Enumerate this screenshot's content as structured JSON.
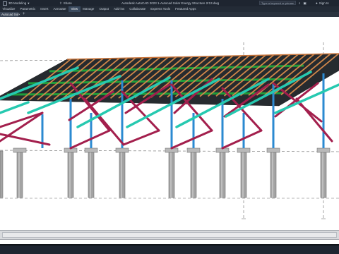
{
  "titlebar": {
    "workspace": "3D Modeling",
    "share": "Share",
    "title": "Autodesk AutoCAD 2023   1-Autocad Solar Energy Structure 2r13.dwg",
    "search_placeholder": "Type a keyword or phrase",
    "sign_in": "Sign In"
  },
  "ribbon": {
    "tabs": [
      "Visualize",
      "Parametric",
      "Insert",
      "Annotate",
      "View",
      "Manage",
      "Output",
      "Add-ins",
      "Collaborate",
      "Express Tools",
      "Featured Apps"
    ],
    "active_tab": "View"
  },
  "document_tab": {
    "label": "Autocad Solar Energy Structure 2r13*",
    "close": "×",
    "add": "+"
  },
  "colors": {
    "panel": "#262b2f",
    "panel_stripe": "#1f9e3a",
    "rafter": "#d1874a",
    "beam": "#26c9b0",
    "brace": "#a31f4d",
    "column": "#2b8ad1",
    "pile": "#9c9c9c",
    "chrome": "#1e2530"
  },
  "icons": [
    "cube-icon",
    "share-icon",
    "search-icon",
    "user-icon",
    "cart-icon",
    "help-icon",
    "close-icon",
    "plus-icon"
  ]
}
